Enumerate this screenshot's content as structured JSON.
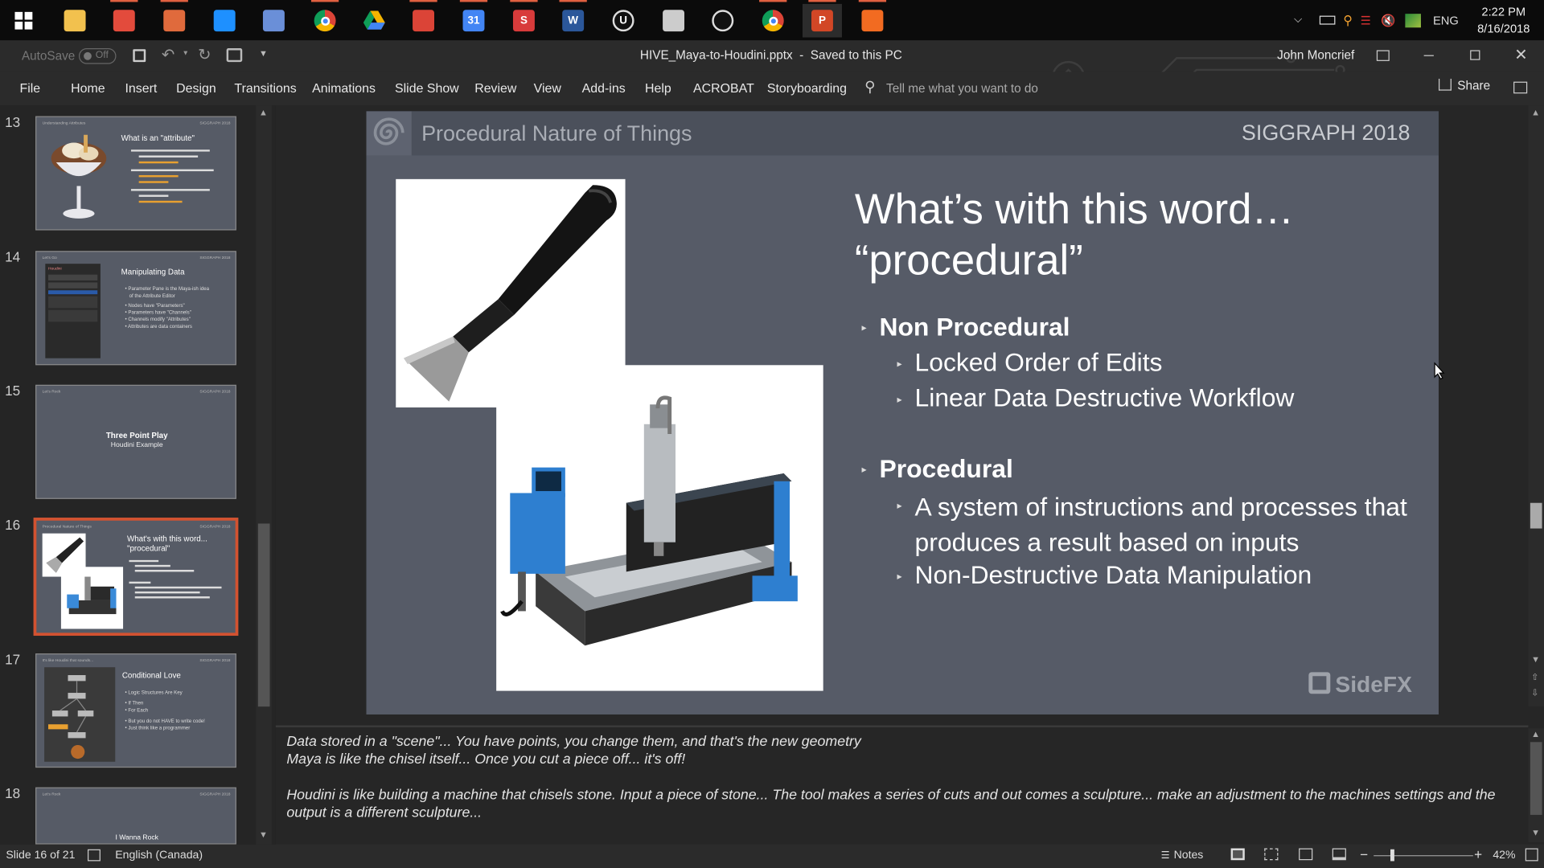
{
  "taskbar": {
    "apps": [
      {
        "icon": "windows-start-icon",
        "color": "#ffffff"
      },
      {
        "icon": "file-explorer-icon",
        "color": "#f2c14e"
      },
      {
        "icon": "app-red-icon",
        "color": "#e34b3c"
      },
      {
        "icon": "app-orange-icon",
        "color": "#e06a3c"
      },
      {
        "icon": "checkbox-app-icon",
        "color": "#1e90ff"
      },
      {
        "icon": "notes-app-icon",
        "color": "#6a8fd8"
      },
      {
        "icon": "chrome-icon",
        "color": "#db4437"
      },
      {
        "icon": "google-drive-icon",
        "color": "#34a853"
      },
      {
        "icon": "gmail-icon",
        "color": "#db4437"
      },
      {
        "icon": "calendar-icon",
        "color": "#4285f4",
        "text": "31"
      },
      {
        "icon": "sheets-app-icon",
        "color": "#d83b3b",
        "text": "S"
      },
      {
        "icon": "word-icon",
        "color": "#2b579a",
        "text": "W"
      },
      {
        "icon": "unreal-icon",
        "color": "#222222",
        "text": "U"
      },
      {
        "icon": "scanner-app-icon",
        "color": "#cccccc"
      },
      {
        "icon": "aperture-app-icon",
        "color": "#555555"
      },
      {
        "icon": "chrome-profile-icon",
        "color": "#db4437"
      },
      {
        "icon": "powerpoint-icon",
        "color": "#d24726",
        "text": "P"
      },
      {
        "icon": "houdini-icon",
        "color": "#f26b21"
      }
    ],
    "language": "ENG",
    "time": "2:22 PM",
    "date": "8/16/2018"
  },
  "titlebar": {
    "autosave_label": "AutoSave",
    "autosave_state": "Off",
    "document_title": "HIVE_Maya-to-Houdini.pptx  -  Saved to this PC",
    "user_name": "John Moncrief"
  },
  "ribbon": {
    "tabs": [
      "File",
      "Home",
      "Insert",
      "Design",
      "Transitions",
      "Animations",
      "Slide Show",
      "Review",
      "View",
      "Add-ins",
      "Help",
      "ACROBAT",
      "Storyboarding"
    ],
    "tell_me_placeholder": "Tell me what you want to do",
    "share_label": "Share"
  },
  "thumbnails": [
    {
      "num": "13",
      "title": "What is an \"attribute\"",
      "header": "Understanding Attributes",
      "footer": "SIGGRAPH 2018"
    },
    {
      "num": "14",
      "title": "Manipulating Data",
      "header": "Houdini",
      "footer": "SIGGRAPH 2018",
      "lines": [
        "• Parameter Pane is the Maya-ish idea",
        "   of the Attribute Editor",
        "• Nodes have \"Parameters\"",
        "• Parameters have \"Channels\"",
        "• Channels modify \"Attributes\"",
        "• Attributes are data containers"
      ]
    },
    {
      "num": "15",
      "title": "Three Point Play",
      "subtitle": "Houdini Example",
      "header": "Let's Rock",
      "footer": "SIGGRAPH 2018"
    },
    {
      "num": "16",
      "title": "What's with this word... \"procedural\"",
      "header": "Procedural Nature of Things",
      "footer": "SIGGRAPH 2018"
    },
    {
      "num": "17",
      "title": "Conditional Love",
      "header": "It's like Houdini that sounds...",
      "footer": "SIGGRAPH 2018",
      "lines": [
        "• Logic Structures Are Key",
        "• If Then",
        "• For Each",
        "• But you do not HAVE to write code!",
        "• Just think like a programmer"
      ]
    },
    {
      "num": "18",
      "title": "I Wanna Rock",
      "header": "Let's Rock",
      "footer": "SIGGRAPH 2018"
    }
  ],
  "slide": {
    "header_title": "Procedural Nature of Things",
    "header_right": "SIGGRAPH 2018",
    "title_line1": "What’s with this word…",
    "title_line2": "“procedural”",
    "b1": "Non Procedural",
    "b1a": "Locked Order of Edits",
    "b1b": "Linear Data Destructive Workflow",
    "b2": "Procedural",
    "b2a_line1": "A system of instructions and processes that",
    "b2a_line2": "produces a result based on inputs",
    "b2b": "Non-Destructive Data Manipulation",
    "logo_text": "SideFX"
  },
  "notes": {
    "line1": "Data stored in a \"scene\"... You have points, you change them, and that's the new geometry",
    "line2": "Maya is like the chisel itself... Once you cut a piece off... it's off!",
    "line3": "Houdini is like building a machine that chisels stone. Input a piece of stone... The tool makes a series of cuts and out comes a sculpture... make an adjustment to the machines settings and the",
    "line4": "output is a different sculpture..."
  },
  "status": {
    "slide_counter": "Slide 16 of 21",
    "language": "English (Canada)",
    "notes_label": "Notes",
    "zoom": "42%"
  }
}
